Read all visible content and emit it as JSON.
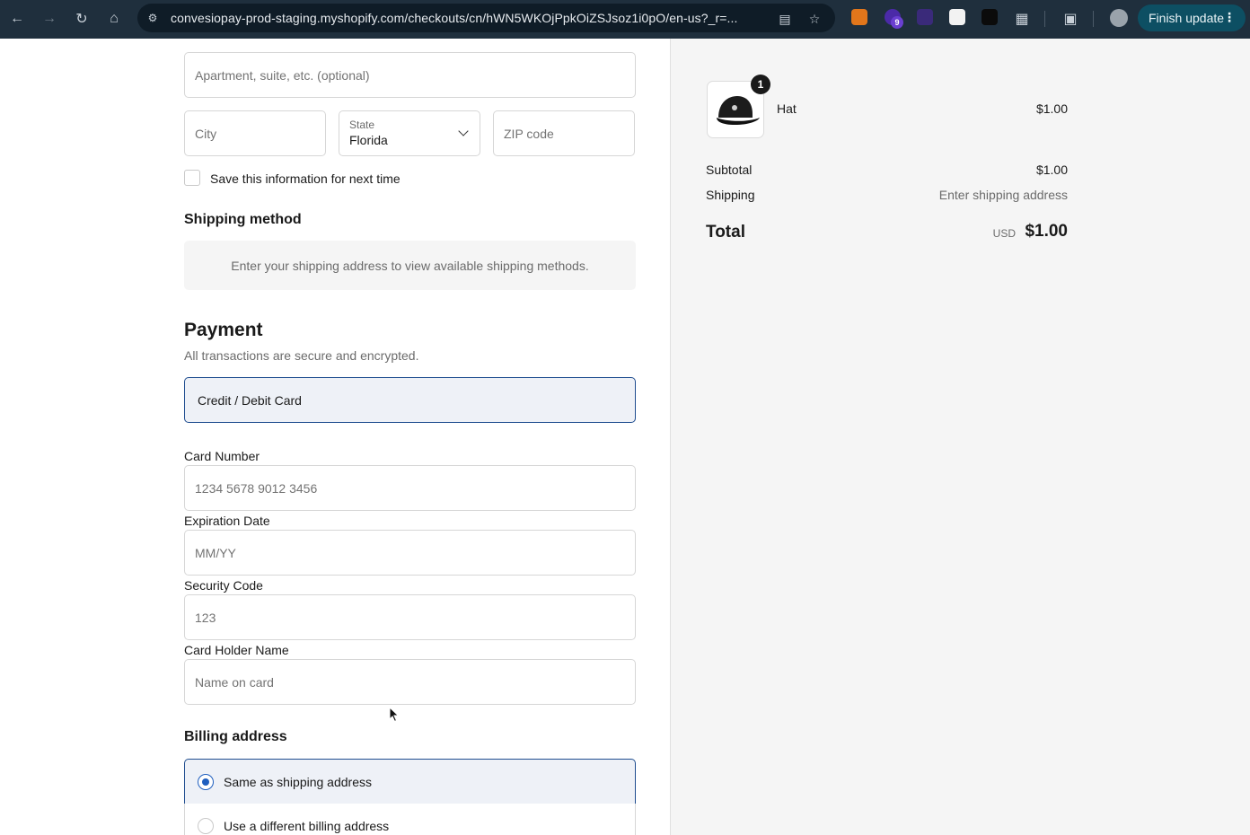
{
  "browser": {
    "url": "convesiopay-prod-staging.myshopify.com/checkouts/cn/hWN5WKOjPpkOiZSJsoz1i0pO/en-us?_r=...",
    "extension_badge_count": "9",
    "finish_update_label": "Finish update"
  },
  "address": {
    "apartment_placeholder": "Apartment, suite, etc. (optional)",
    "city_placeholder": "City",
    "state_label": "State",
    "state_value": "Florida",
    "zip_placeholder": "ZIP code",
    "save_info_label": "Save this information for next time"
  },
  "shipping_method": {
    "heading": "Shipping method",
    "notice": "Enter your shipping address to view available shipping methods."
  },
  "payment": {
    "heading": "Payment",
    "subheading": "All transactions are secure and encrypted.",
    "method_label": "Credit / Debit Card",
    "card_number_label": "Card Number",
    "card_number_placeholder": "1234 5678 9012 3456",
    "expiration_label": "Expiration Date",
    "expiration_placeholder": "MM/YY",
    "security_label": "Security Code",
    "security_placeholder": "123",
    "holder_label": "Card Holder Name",
    "holder_placeholder": "Name on card"
  },
  "billing": {
    "heading": "Billing address",
    "options": [
      {
        "label": "Same as shipping address",
        "selected": true
      },
      {
        "label": "Use a different billing address",
        "selected": false
      }
    ]
  },
  "summary": {
    "item": {
      "name": "Hat",
      "price": "$1.00",
      "quantity": "1"
    },
    "subtotal_label": "Subtotal",
    "subtotal_value": "$1.00",
    "shipping_label": "Shipping",
    "shipping_value": "Enter shipping address",
    "total_label": "Total",
    "total_currency": "USD",
    "total_value": "$1.00"
  },
  "colors": {
    "toolbar_bg": "#1f2f3d",
    "accent": "#1f4d8f",
    "summary_bg": "#f5f5f5"
  }
}
